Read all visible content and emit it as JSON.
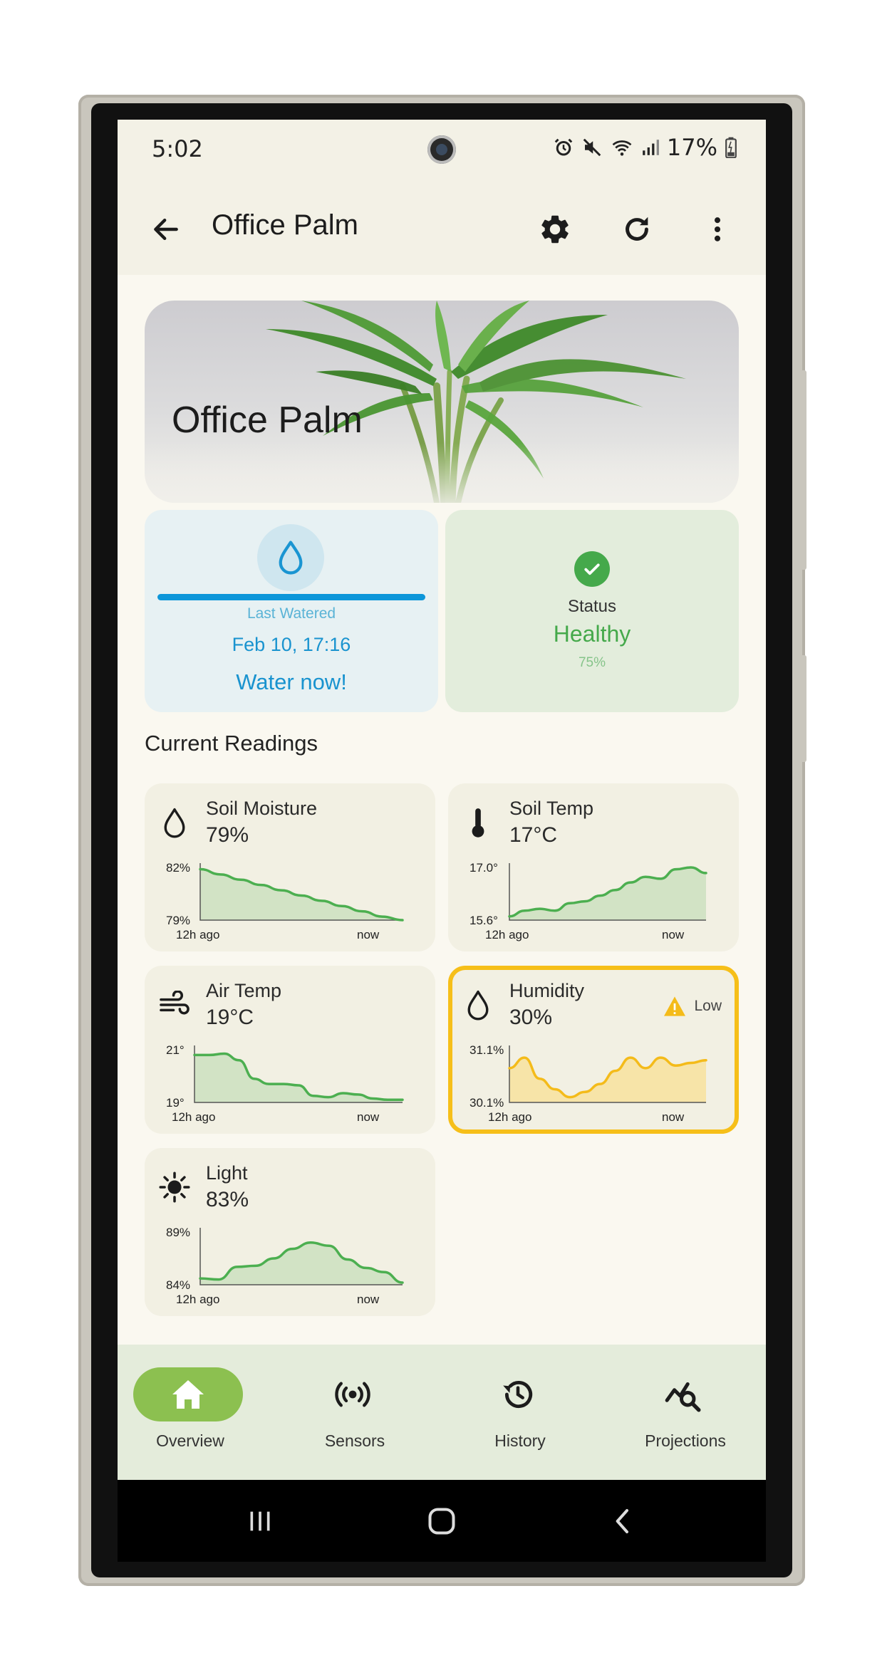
{
  "status_bar": {
    "time": "5:02",
    "battery": "17%",
    "icons": [
      "alarm-icon",
      "mute-icon",
      "wifi-icon",
      "signal-icon",
      "battery-icon"
    ]
  },
  "app_bar": {
    "title": "Office Palm",
    "icons": [
      "back-arrow-icon",
      "gear-icon",
      "refresh-icon",
      "more-vert-icon"
    ]
  },
  "hero": {
    "title": "Office Palm"
  },
  "water_card": {
    "progress": 1.0,
    "label": "Last Watered",
    "date": "Feb 10, 17:16",
    "action": "Water now!"
  },
  "status_card": {
    "label": "Status",
    "value": "Healthy",
    "percent": "75%"
  },
  "section_title": "Current Readings",
  "sensors": [
    {
      "name": "Soil Moisture",
      "value": "79%",
      "icon": "water-drop-icon",
      "y_max_label": "82%",
      "y_min_label": "79%",
      "x_start": "12h ago",
      "x_end": "now",
      "color": "#4caf50",
      "chart_data": {
        "type": "area",
        "ylim": [
          79,
          82
        ],
        "values": [
          81.9,
          81.6,
          81.3,
          81.0,
          80.7,
          80.4,
          80.1,
          79.8,
          79.5,
          79.2,
          79.0
        ]
      }
    },
    {
      "name": "Soil Temp",
      "value": "17°C",
      "icon": "thermometer-icon",
      "y_max_label": "17.0°",
      "y_min_label": "15.6°",
      "x_start": "12h ago",
      "x_end": "now",
      "color": "#4caf50",
      "chart_data": {
        "type": "area",
        "ylim": [
          15.6,
          17.0
        ],
        "values": [
          15.7,
          15.85,
          15.9,
          15.85,
          16.05,
          16.1,
          16.25,
          16.4,
          16.6,
          16.75,
          16.7,
          16.95,
          17.0,
          16.85
        ]
      }
    },
    {
      "name": "Air Temp",
      "value": "19°C",
      "icon": "wind-icon",
      "y_max_label": "21°",
      "y_min_label": "19°",
      "x_start": "12h ago",
      "x_end": "now",
      "color": "#4caf50",
      "chart_data": {
        "type": "area",
        "ylim": [
          19,
          21
        ],
        "values": [
          20.8,
          20.8,
          20.85,
          20.6,
          19.9,
          19.7,
          19.7,
          19.65,
          19.25,
          19.2,
          19.35,
          19.3,
          19.15,
          19.1,
          19.1
        ]
      }
    },
    {
      "name": "Humidity",
      "value": "30%",
      "icon": "water-drop-icon",
      "warning": "Low",
      "warning_icon": "warning-triangle-icon",
      "y_max_label": "31.1%",
      "y_min_label": "30.1%",
      "x_start": "12h ago",
      "x_end": "now",
      "color": "#f4bb1a",
      "chart_data": {
        "type": "area",
        "ylim": [
          30.1,
          31.1
        ],
        "values": [
          30.75,
          30.95,
          30.55,
          30.35,
          30.2,
          30.3,
          30.45,
          30.7,
          30.95,
          30.75,
          30.95,
          30.8,
          30.85,
          30.9
        ]
      }
    },
    {
      "name": "Light",
      "value": "83%",
      "icon": "sun-icon",
      "y_max_label": "89%",
      "y_min_label": "84%",
      "x_start": "12h ago",
      "x_end": "now",
      "color": "#4caf50",
      "chart_data": {
        "type": "area",
        "ylim": [
          84,
          89
        ],
        "values": [
          84.6,
          84.5,
          85.7,
          85.8,
          86.5,
          87.4,
          88.0,
          87.7,
          86.4,
          85.6,
          85.2,
          84.2
        ]
      }
    }
  ],
  "bottom_nav": [
    {
      "label": "Overview",
      "icon": "home-icon",
      "active": true
    },
    {
      "label": "Sensors",
      "icon": "sensors-icon",
      "active": false
    },
    {
      "label": "History",
      "icon": "history-icon",
      "active": false
    },
    {
      "label": "Projections",
      "icon": "projections-icon",
      "active": false
    }
  ],
  "system_nav": [
    "recents-icon",
    "home-circle-icon",
    "back-chevron-icon"
  ]
}
